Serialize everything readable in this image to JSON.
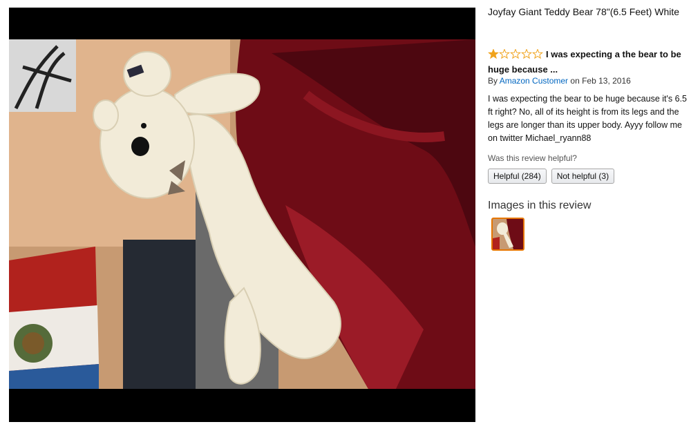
{
  "product": {
    "title": "Joyfay Giant Teddy Bear 78\"(6.5 Feet) White"
  },
  "review": {
    "rating": 1,
    "rating_max": 5,
    "star_color": "#f0a31c",
    "headline": "I was expecting a the bear to be huge because ...",
    "by_prefix": "By",
    "author": "Amazon Customer",
    "date": "on Feb 13, 2016",
    "body": "I was expecting the bear to be huge because it's 6.5 ft right? No, all of its height is from its legs and the legs are longer than its upper body. Ayyy follow me on twitter Michael_ryann88",
    "helpful_question": "Was this review helpful?",
    "helpful_label": "Helpful (284)",
    "not_helpful_label": "Not helpful (3)"
  },
  "images_section": {
    "title": "Images in this review"
  },
  "colors": {
    "link": "#0066c0",
    "thumb_border": "#e77600"
  }
}
